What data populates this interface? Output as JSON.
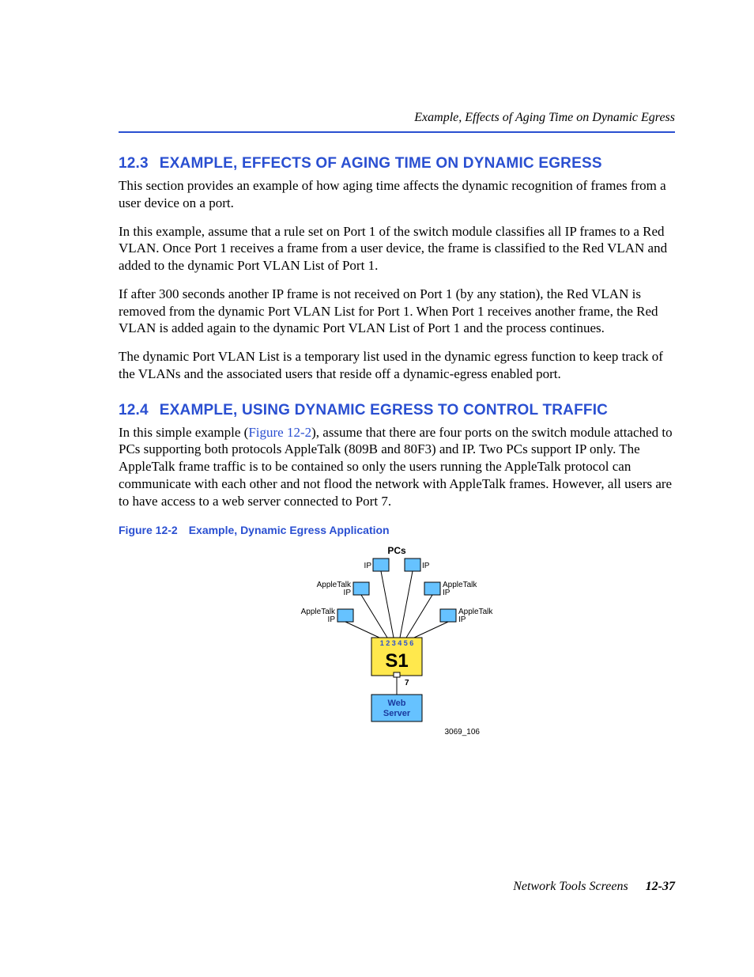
{
  "runningHead": "Example, Effects of Aging Time on Dynamic Egress",
  "section123": {
    "num": "12.3",
    "title": "EXAMPLE, EFFECTS OF AGING TIME ON DYNAMIC EGRESS",
    "p1": "This section provides an example of how aging time affects the dynamic recognition of frames from a user device on a port.",
    "p2": "In this example, assume that a rule set on Port 1 of the switch module classifies all IP frames to a Red VLAN. Once Port 1 receives a frame from a user device, the frame is classified to the Red VLAN and added to the dynamic Port VLAN List of Port 1.",
    "p3": "If after 300 seconds another IP frame is not received on Port 1 (by any station), the Red VLAN is removed from the dynamic Port VLAN List for Port 1. When Port 1 receives another frame, the Red VLAN is added again to the dynamic Port VLAN List of Port 1 and the process continues.",
    "p4": "The dynamic Port VLAN List is a temporary list used in the dynamic egress function to keep track of the VLANs and the associated users that reside off a dynamic-egress enabled port."
  },
  "section124": {
    "num": "12.4",
    "title": "EXAMPLE, USING DYNAMIC EGRESS TO CONTROL TRAFFIC",
    "p1a": "In this simple example (",
    "p1link": "Figure 12-2",
    "p1b": "), assume that there are four ports on the switch module attached to PCs supporting both protocols AppleTalk (809B and 80F3) and IP. Two PCs support IP only. The AppleTalk frame traffic is to be contained so only the users running the AppleTalk protocol can communicate with each other and not flood the network with AppleTalk frames. However, all users are to have access to a web server connected to Port 7."
  },
  "figure": {
    "num": "Figure 12-2",
    "caption": "Example, Dynamic Egress Application",
    "labels": {
      "pcs": "PCs",
      "ip": "IP",
      "appletalk": "AppleTalk",
      "switch": "S1",
      "ports": "1 2 3 4 5 6",
      "port7": "7",
      "web1": "Web",
      "web2": "Server",
      "drawingId": "3069_106"
    }
  },
  "footer": {
    "text": "Network Tools Screens",
    "page": "12-37"
  }
}
